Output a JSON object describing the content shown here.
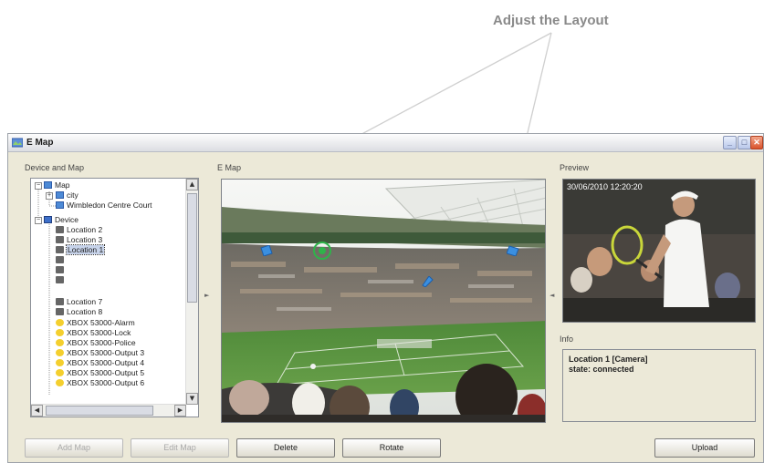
{
  "annotation": {
    "text": "Adjust the Layout"
  },
  "window": {
    "title": "E Map",
    "minimize": "_",
    "maximize": "□",
    "close": "✕"
  },
  "panels": {
    "device_map": "Device and Map",
    "emap": "E Map",
    "preview": "Preview",
    "info": "Info"
  },
  "tree": {
    "items": [
      {
        "label": "Map",
        "icon": "map-icon"
      },
      {
        "label": "city",
        "icon": "map-icon"
      },
      {
        "label": "Wimbledon Centre Court",
        "icon": "map-icon"
      },
      {
        "label": "Device",
        "icon": "monitor-icon"
      },
      {
        "label": "Location 2",
        "icon": "camera-icon"
      },
      {
        "label": "Location 3",
        "icon": "camera-icon"
      },
      {
        "label": "Location 1",
        "icon": "camera-icon"
      },
      {
        "label": "",
        "icon": "camera-icon"
      },
      {
        "label": "",
        "icon": "camera-icon"
      },
      {
        "label": "",
        "icon": "camera-icon"
      },
      {
        "label": "Location 7",
        "icon": "camera-icon"
      },
      {
        "label": "Location 8",
        "icon": "camera-icon"
      },
      {
        "label": "XBOX 53000-Alarm",
        "icon": "bulb-icon"
      },
      {
        "label": "XBOX 53000-Lock",
        "icon": "bulb-icon"
      },
      {
        "label": "XBOX 53000-Police",
        "icon": "bulb-icon"
      },
      {
        "label": "XBOX 53000-Output 3",
        "icon": "bulb-icon"
      },
      {
        "label": "XBOX 53000-Output 4",
        "icon": "bulb-icon"
      },
      {
        "label": "XBOX 53000-Output 5",
        "icon": "bulb-icon"
      },
      {
        "label": "XBOX 53000-Output 6",
        "icon": "bulb-icon"
      }
    ]
  },
  "preview": {
    "timestamp": "30/06/2010  12:20:20"
  },
  "info": {
    "line1": "Location 1 [Camera]",
    "line2": "state: connected"
  },
  "buttons": {
    "add_map": "Add Map",
    "edit_map": "Edit Map",
    "delete": "Delete",
    "rotate": "Rotate",
    "upload": "Upload"
  },
  "colors": {
    "window_bg": "#ece9d8",
    "selection": "#c7d3ea",
    "camera_marker": "#3a8fe0",
    "selected_marker": "#2fb34a"
  }
}
